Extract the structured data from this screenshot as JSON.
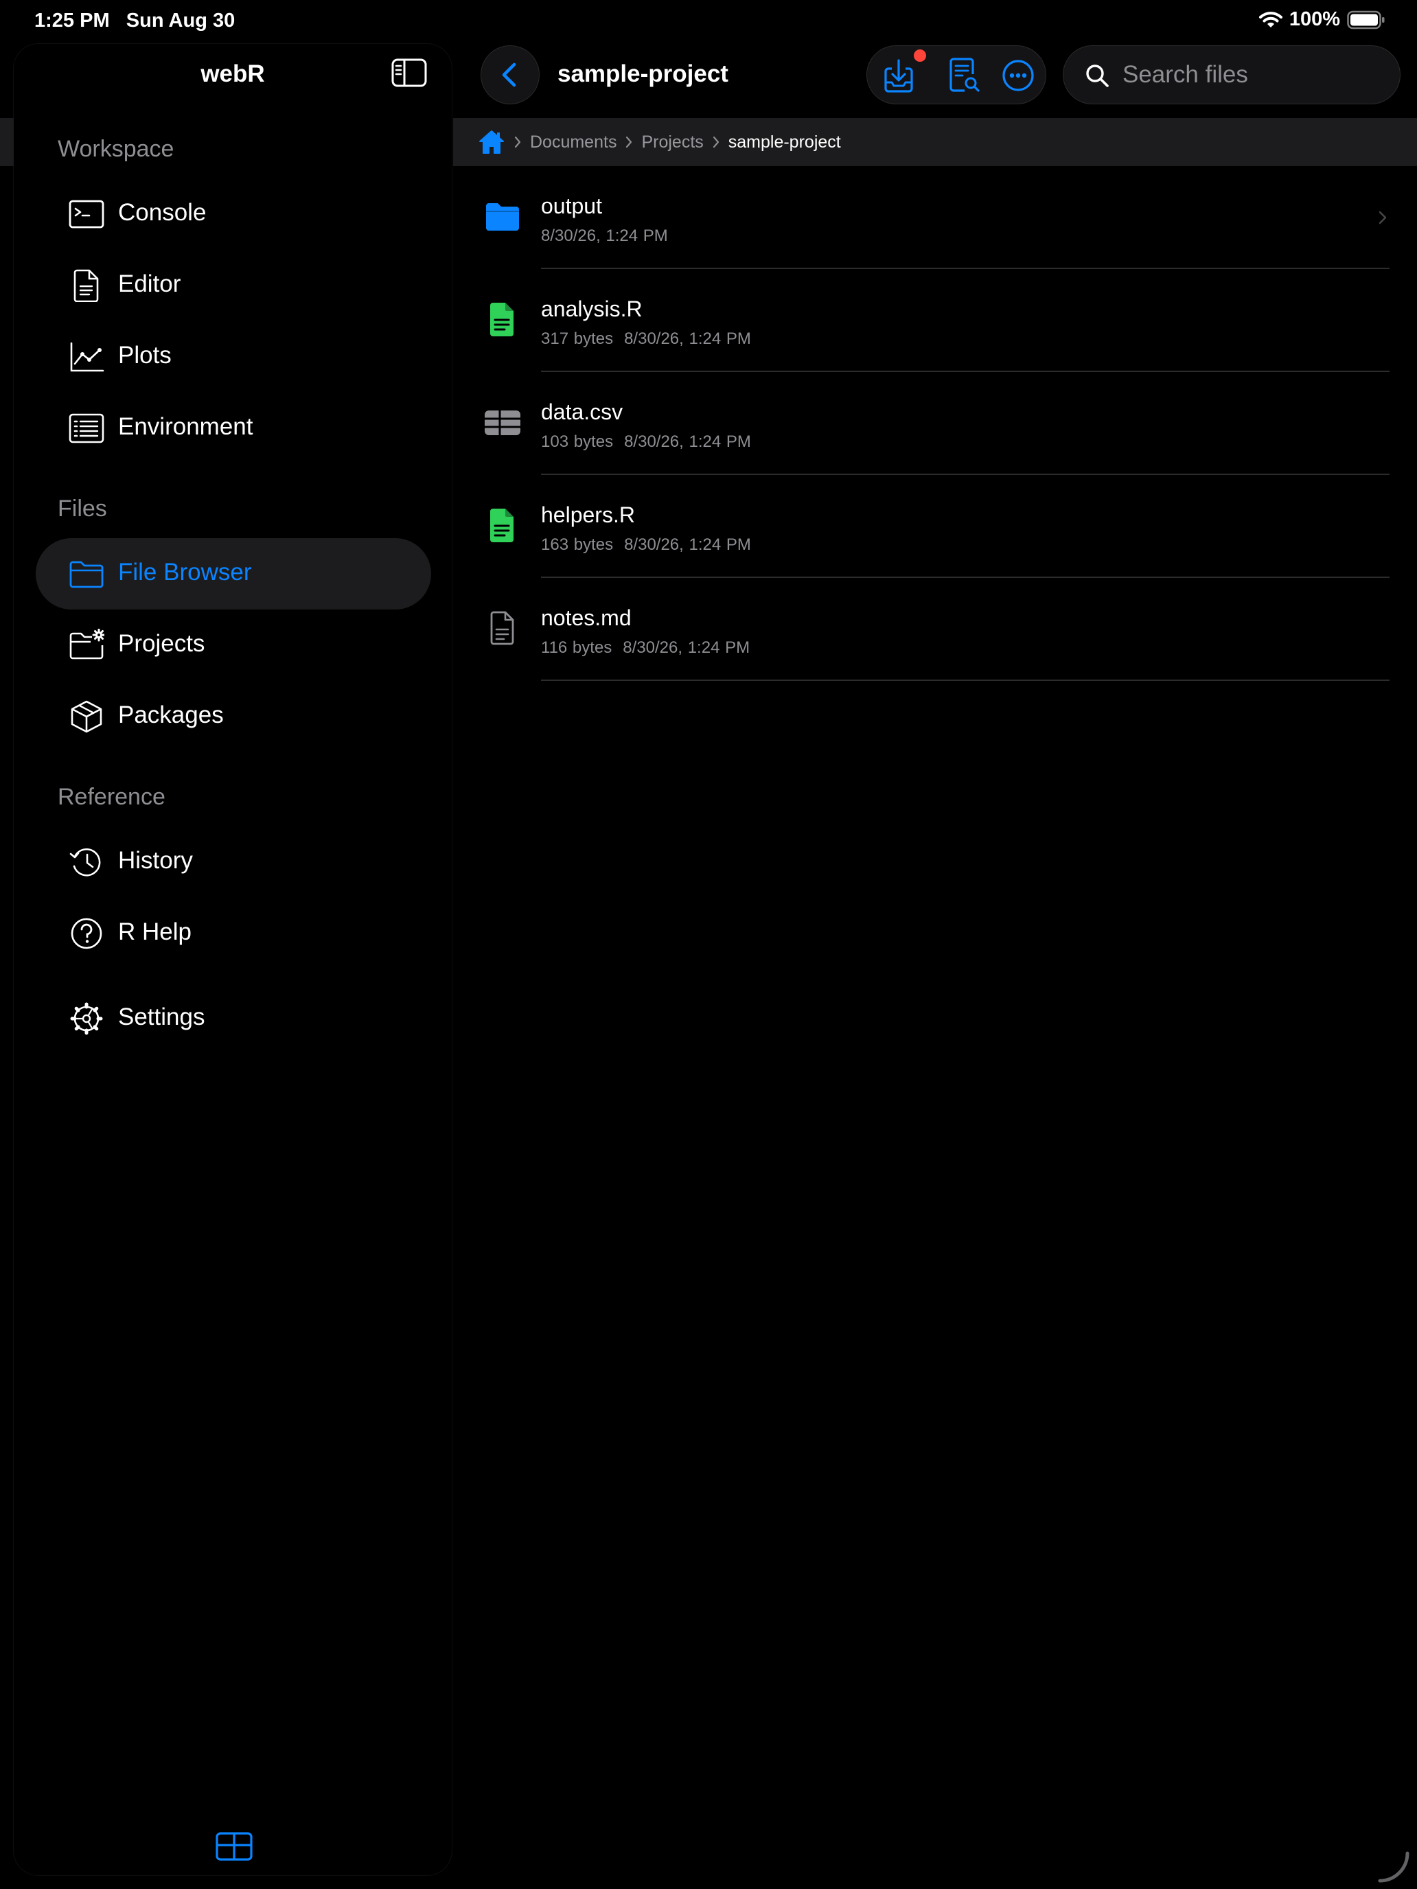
{
  "status_bar": {
    "time": "1:25 PM",
    "date": "Sun Aug 30",
    "battery": "100%"
  },
  "sidebar": {
    "title": "webR",
    "sections": {
      "workspace": "Workspace",
      "files": "Files",
      "reference": "Reference"
    },
    "items": {
      "console": "Console",
      "editor": "Editor",
      "plots": "Plots",
      "environment": "Environment",
      "file_browser": "File Browser",
      "projects": "Projects",
      "packages": "Packages",
      "history": "History",
      "r_help": "R Help",
      "settings": "Settings"
    },
    "active_item": "File Browser"
  },
  "header": {
    "title": "sample-project",
    "search_placeholder": "Search files"
  },
  "breadcrumb": {
    "crumbs": [
      "Documents",
      "Projects",
      "sample-project"
    ]
  },
  "files": [
    {
      "name": "output",
      "meta": "8/30/26, 1:24 PM",
      "kind": "folder-icon"
    },
    {
      "name": "analysis.R",
      "size": "317 bytes",
      "meta": "8/30/26, 1:24 PM",
      "kind": "r-script-icon"
    },
    {
      "name": "data.csv",
      "size": "103 bytes",
      "meta": "8/30/26, 1:24 PM",
      "kind": "table-icon"
    },
    {
      "name": "helpers.R",
      "size": "163 bytes",
      "meta": "8/30/26, 1:24 PM",
      "kind": "r-script-icon"
    },
    {
      "name": "notes.md",
      "size": "116 bytes",
      "meta": "8/30/26, 1:24 PM",
      "kind": "document-icon"
    }
  ],
  "colors": {
    "accent": "#0a84ff",
    "r_file": "#30d158",
    "badge": "#ff453a",
    "background": "#000000",
    "panel": "#1c1c1e",
    "secondary_text": "#8e8e93"
  }
}
